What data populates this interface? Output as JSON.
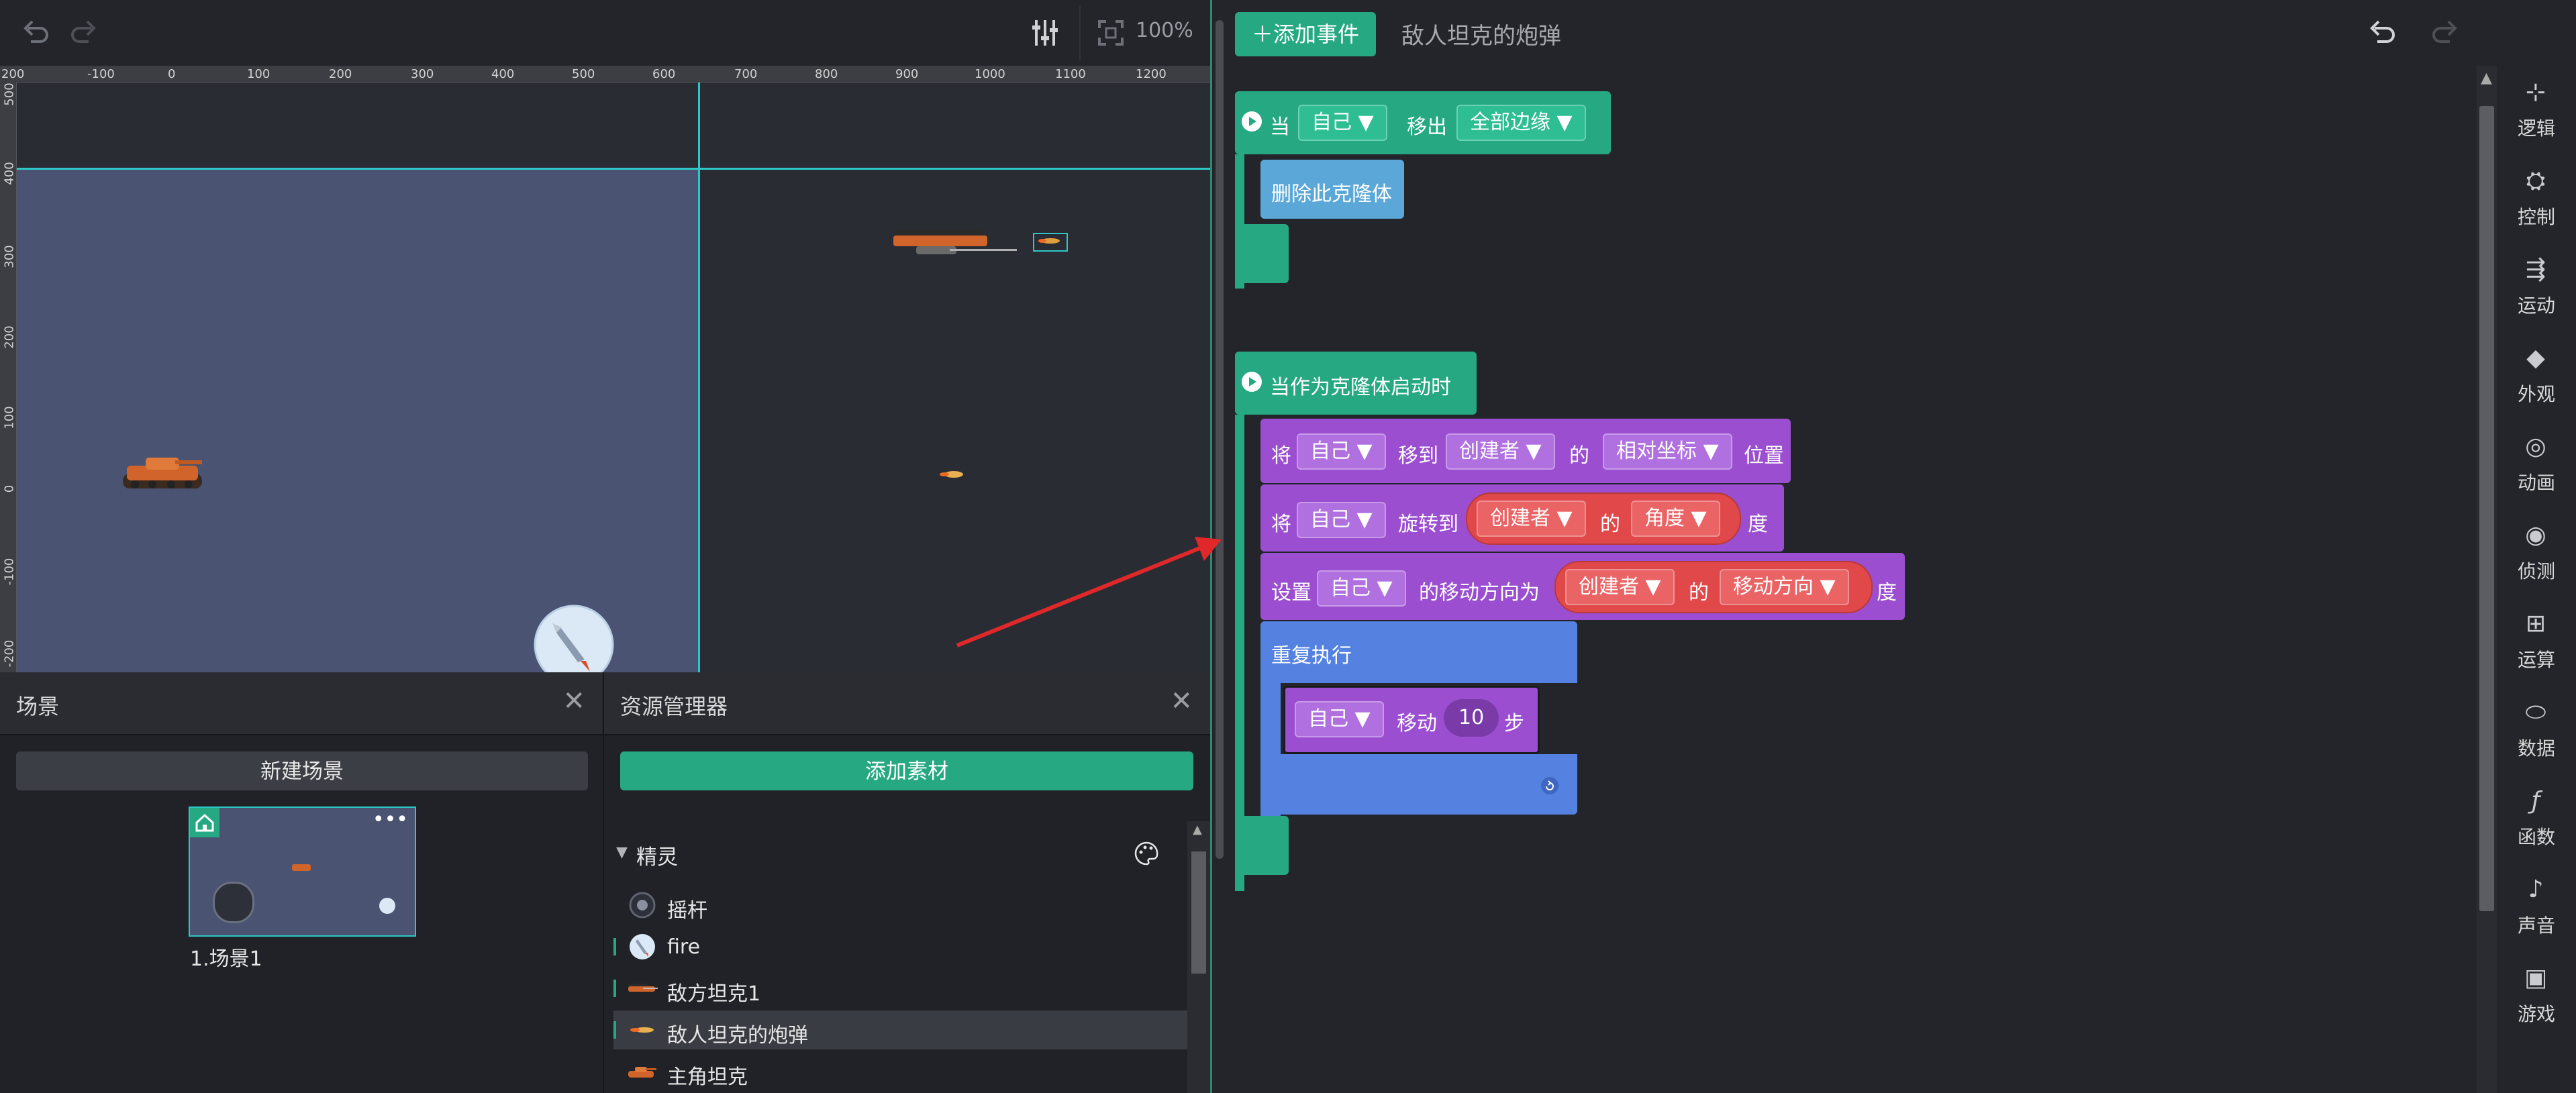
{
  "toolbar": {
    "zoom": "100%"
  },
  "ruler": {
    "top": [
      "200",
      "-100",
      "0",
      "100",
      "200",
      "300",
      "400",
      "500",
      "600",
      "700",
      "800",
      "900",
      "1000",
      "1100",
      "1200"
    ],
    "left": [
      "500",
      "400",
      "300",
      "200",
      "100",
      "0",
      "-100",
      "-200"
    ]
  },
  "scene_panel": {
    "title": "场景",
    "new_button": "新建场景",
    "scene_name": "1.场景1"
  },
  "asset_panel": {
    "title": "资源管理器",
    "add_button": "添加素材",
    "section": "精灵",
    "items": [
      {
        "label": "摇杆",
        "icon": "joystick-icon"
      },
      {
        "label": "fire",
        "icon": "rocket-icon"
      },
      {
        "label": "敌方坦克1",
        "icon": "tank-icon"
      },
      {
        "label": "敌人坦克的炮弹",
        "icon": "bullet-icon"
      },
      {
        "label": "主角坦克",
        "icon": "tank-icon"
      }
    ]
  },
  "code": {
    "add_event": "添加事件",
    "sprite_title": "敌人坦克的炮弹",
    "event1": {
      "when": "当",
      "target": "自己",
      "action": "移出",
      "edge": "全部边缘"
    },
    "delete_clone": "删除此克隆体",
    "event2": {
      "title": "当作为克隆体启动时"
    },
    "move_to": {
      "lead": "将",
      "target": "自己",
      "verb": "移到",
      "ref": "创建者",
      "of": "的",
      "prop": "相对坐标",
      "tail": "位置"
    },
    "rotate_to": {
      "lead": "将",
      "target": "自己",
      "verb": "旋转到",
      "ref": "创建者",
      "of": "的",
      "prop": "角度",
      "tail": "度"
    },
    "set_dir": {
      "lead": "设置",
      "target": "自己",
      "verb": "的移动方向为",
      "ref": "创建者",
      "of": "的",
      "prop": "移动方向",
      "tail": "度"
    },
    "repeat": {
      "label": "重复执行"
    },
    "move_steps": {
      "target": "自己",
      "verb": "移动",
      "value": "10",
      "tail": "步"
    }
  },
  "categories": [
    {
      "label": "逻辑",
      "icon": "logic-icon"
    },
    {
      "label": "控制",
      "icon": "control-icon"
    },
    {
      "label": "运动",
      "icon": "motion-icon"
    },
    {
      "label": "外观",
      "icon": "looks-icon"
    },
    {
      "label": "动画",
      "icon": "animation-icon"
    },
    {
      "label": "侦测",
      "icon": "sensing-icon"
    },
    {
      "label": "运算",
      "icon": "operators-icon"
    },
    {
      "label": "数据",
      "icon": "data-icon"
    },
    {
      "label": "函数",
      "icon": "function-icon"
    },
    {
      "label": "声音",
      "icon": "sound-icon"
    },
    {
      "label": "游戏",
      "icon": "game-icon"
    }
  ],
  "colors": {
    "accent": "#26a883",
    "guide": "#2ec6c6",
    "motion": "#9b4fd0",
    "control": "#5581e0",
    "sensing": "#5aa7d8",
    "operator": "#e0484a"
  }
}
